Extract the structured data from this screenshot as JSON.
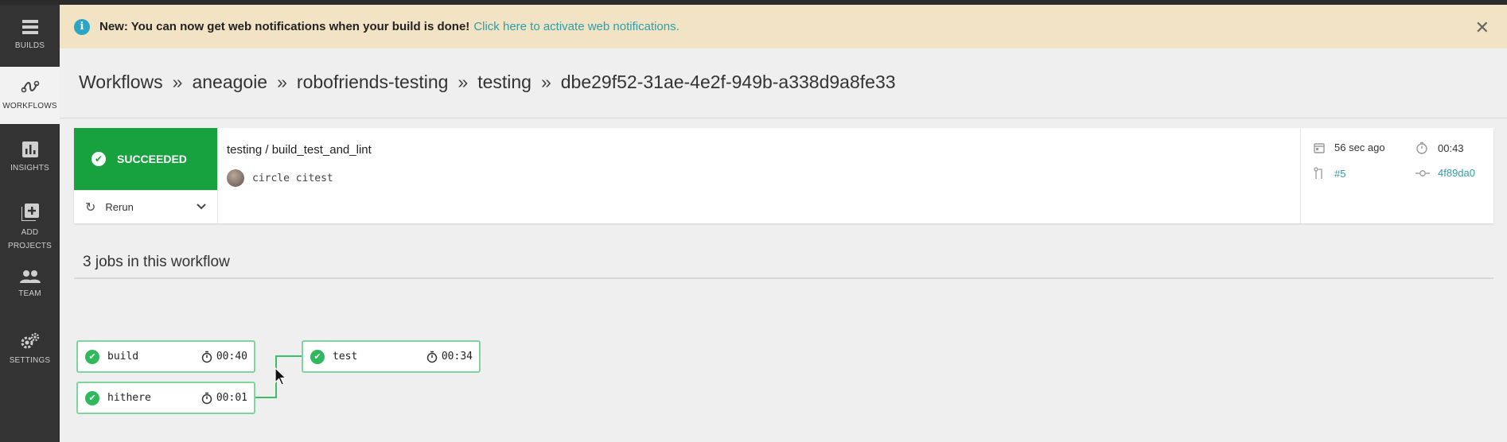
{
  "sidebar": {
    "items": [
      {
        "label": "BUILDS",
        "icon": "list-icon"
      },
      {
        "label": "WORKFLOWS",
        "icon": "workflows-icon"
      },
      {
        "label": "INSIGHTS",
        "icon": "bar-chart-icon"
      },
      {
        "label": "ADD PROJECTS",
        "icon": "add-box-icon"
      },
      {
        "label": "TEAM",
        "icon": "people-icon"
      },
      {
        "label": "SETTINGS",
        "icon": "gear-icon"
      }
    ]
  },
  "banner": {
    "bold": "New: You can now get web notifications when your build is done!",
    "link": "Click here to activate web notifications."
  },
  "breadcrumb": [
    "Workflows",
    "aneagoie",
    "robofriends-testing",
    "testing",
    "dbe29f52-31ae-4e2f-949b-a338d9a8fe33"
  ],
  "breadcrumb_sep": "»",
  "summary": {
    "status": "SUCCEEDED",
    "rerun": "Rerun",
    "job_title": "testing / build_test_and_lint",
    "commit_message": "circle citest",
    "time_ago": "56 sec ago",
    "duration": "00:43",
    "pipeline_number": "#5",
    "commit_hash": "4f89da0"
  },
  "jobs_heading": "3 jobs in this workflow",
  "jobs": [
    {
      "name": "build",
      "duration": "00:40"
    },
    {
      "name": "hithere",
      "duration": "00:01"
    },
    {
      "name": "test",
      "duration": "00:34"
    }
  ],
  "colors": {
    "success": "#18a23f",
    "link": "#2f9ea8",
    "banner": "#f1e3c3",
    "sidebar": "#333333"
  }
}
